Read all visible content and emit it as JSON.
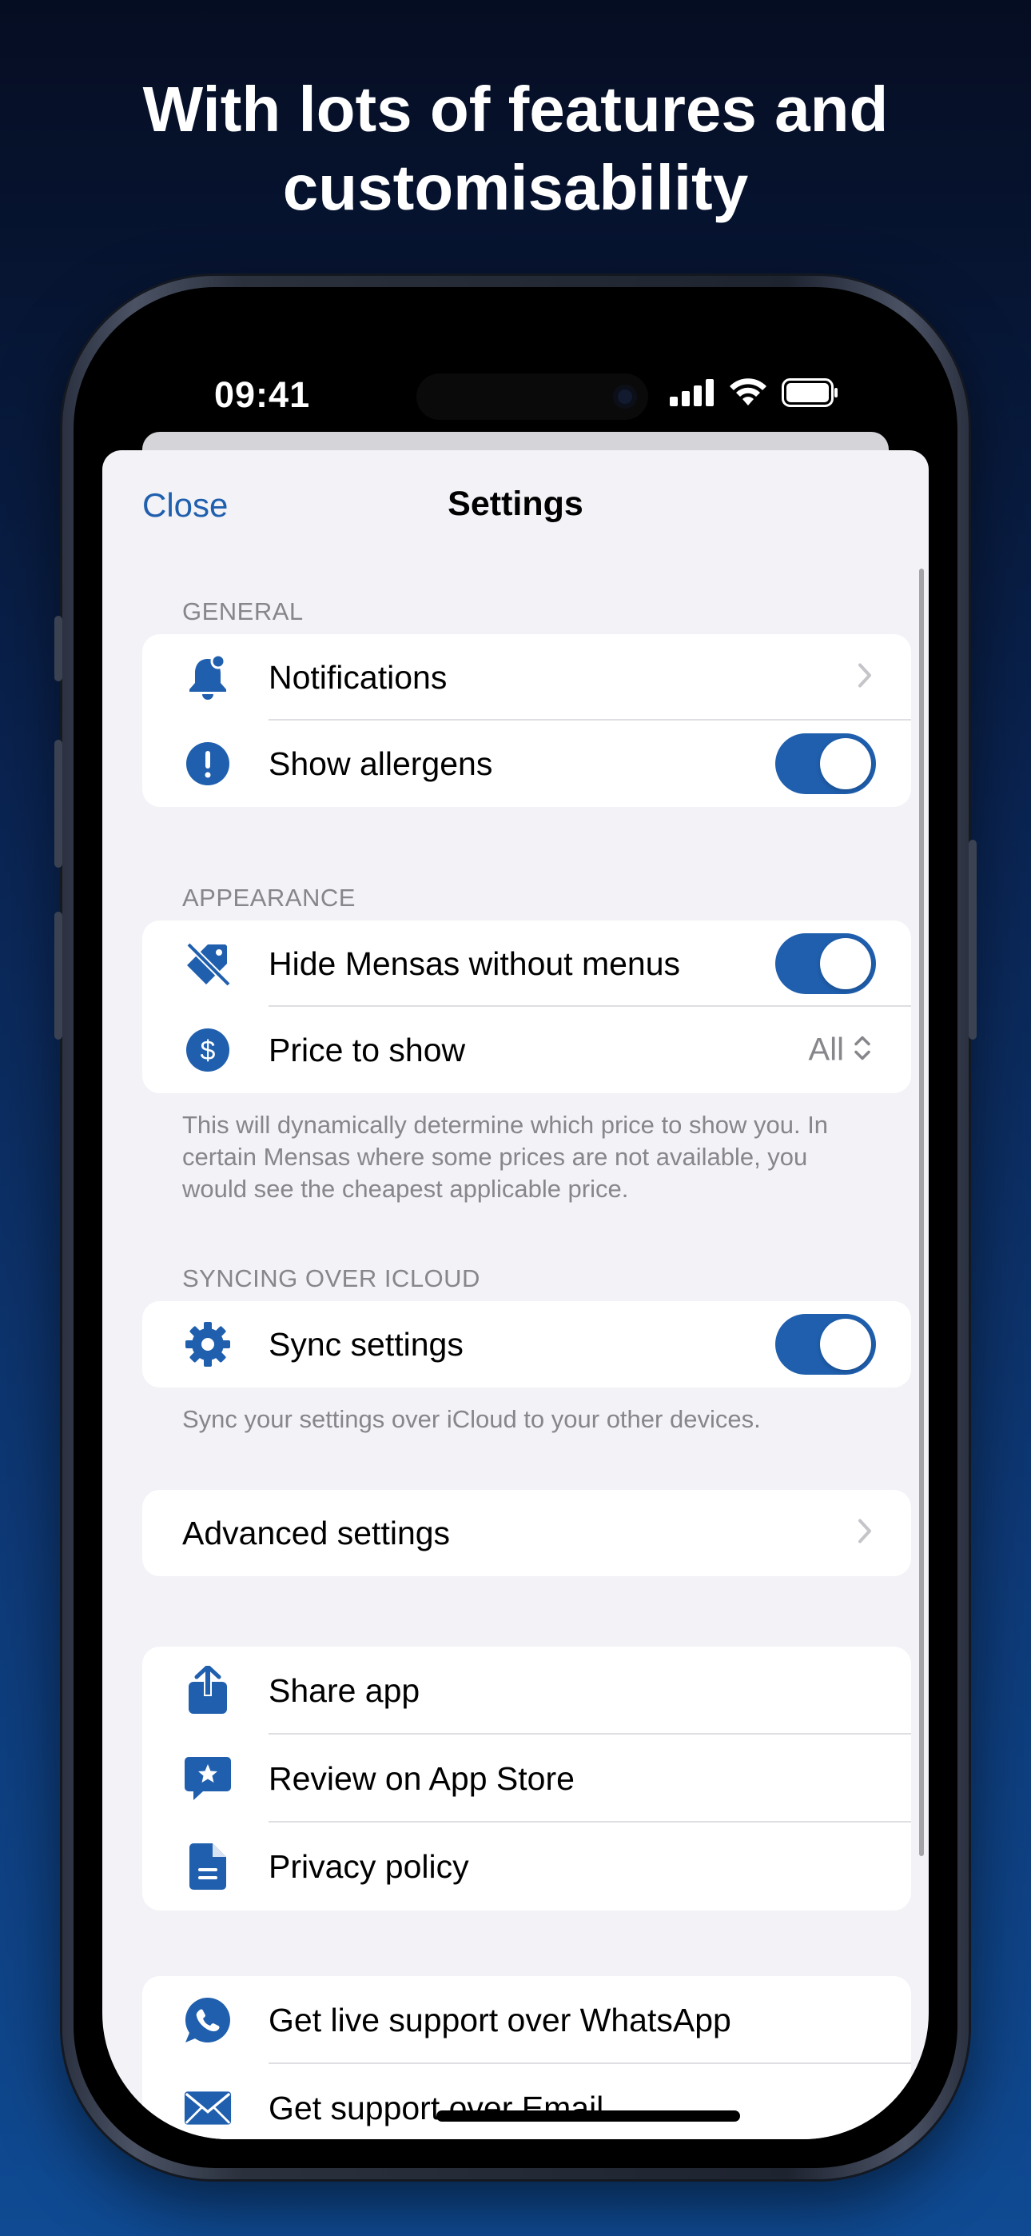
{
  "headline": {
    "line1": "With lots of features and",
    "line2": "customisability"
  },
  "status_bar": {
    "time": "09:41"
  },
  "nav": {
    "close": "Close",
    "title": "Settings"
  },
  "sections": {
    "general": {
      "header": "GENERAL",
      "notifications": "Notifications",
      "show_allergens": "Show allergens",
      "show_allergens_on": true
    },
    "appearance": {
      "header": "APPEARANCE",
      "hide_mensas": "Hide Mensas without menus",
      "hide_mensas_on": true,
      "price_label": "Price to show",
      "price_value": "All",
      "footer": "This will dynamically determine which price to show you. In certain Mensas where some prices are not available, you would see the cheapest applicable price."
    },
    "syncing": {
      "header": "SYNCING OVER ICLOUD",
      "sync_settings": "Sync settings",
      "sync_on": true,
      "footer": "Sync your settings over iCloud to your other devices."
    },
    "advanced": {
      "label": "Advanced settings"
    },
    "about": {
      "share": "Share app",
      "review": "Review on App Store",
      "privacy": "Privacy policy"
    },
    "support": {
      "whatsapp": "Get live support over WhatsApp",
      "email": "Get support over Email"
    }
  },
  "colors": {
    "accent": "#1f5fae",
    "grouped_bg": "#f2f2f7",
    "secondary_text": "#86868b"
  }
}
